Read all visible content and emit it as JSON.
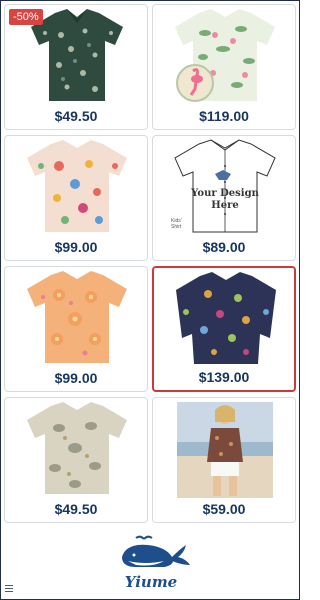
{
  "products": [
    {
      "price": "$49.50",
      "badge": "-50%",
      "image": "dark-green-floral-shirt"
    },
    {
      "price": "$119.00",
      "image": "flamingo-pattern-shirt"
    },
    {
      "price": "$99.00",
      "image": "peach-floral-shirt"
    },
    {
      "price": "$89.00",
      "image": "custom-design-shirt-outline",
      "overlay_text": "Your Design Here",
      "side_text": "Kids' Shirt"
    },
    {
      "price": "$99.00",
      "image": "orange-floral-shirt"
    },
    {
      "price": "$139.00",
      "image": "navy-botanical-shirt",
      "selected": true
    },
    {
      "price": "$49.50",
      "image": "beige-shell-pattern-shirt"
    },
    {
      "price": "$59.00",
      "image": "woman-beach-shirt-photo"
    }
  ],
  "footer": {
    "brand": "Yiume",
    "logo": "whale-logo-icon"
  },
  "colors": {
    "price": "#17365d",
    "badge": "#d64541",
    "selected_border": "#cc3b3b"
  }
}
